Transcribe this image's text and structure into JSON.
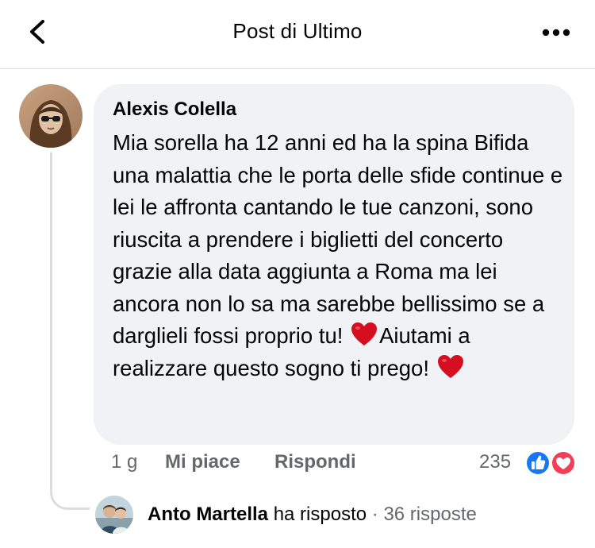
{
  "header": {
    "title": "Post di Ultimo",
    "back_icon": "chevron-left-icon",
    "more_icon": "more-horizontal-icon"
  },
  "comment": {
    "author": "Alexis Colella",
    "text_part1": "Mia sorella ha 12 anni ed ha la spina Bifida una malattia che le porta delle sfide continue e lei le affronta cantando le tue canzoni, sono riuscita a prendere i biglietti del concerto grazie alla data aggiunta a Roma ma lei ancora non lo sa ma sarebbe bellissimo se a darglieli fossi proprio tu!",
    "text_part2": "Aiutami a realizzare questo sogno ti prego!",
    "emoji": "red-heart-icon",
    "time": "1 g",
    "like_label": "Mi piace",
    "reply_label": "Rispondi",
    "reaction_count": "235",
    "reactions": [
      "like-reaction-icon",
      "love-reaction-icon"
    ]
  },
  "replies": {
    "author": "Anto Martella",
    "verb": "ha risposto",
    "separator": "·",
    "count_label": "36 risposte"
  },
  "colors": {
    "bubble": "#f0f2f5",
    "secondary_text": "#65676b",
    "like_blue": "#1877f2",
    "love_red": "#f33e58",
    "heart_red": "#d50f1f"
  }
}
